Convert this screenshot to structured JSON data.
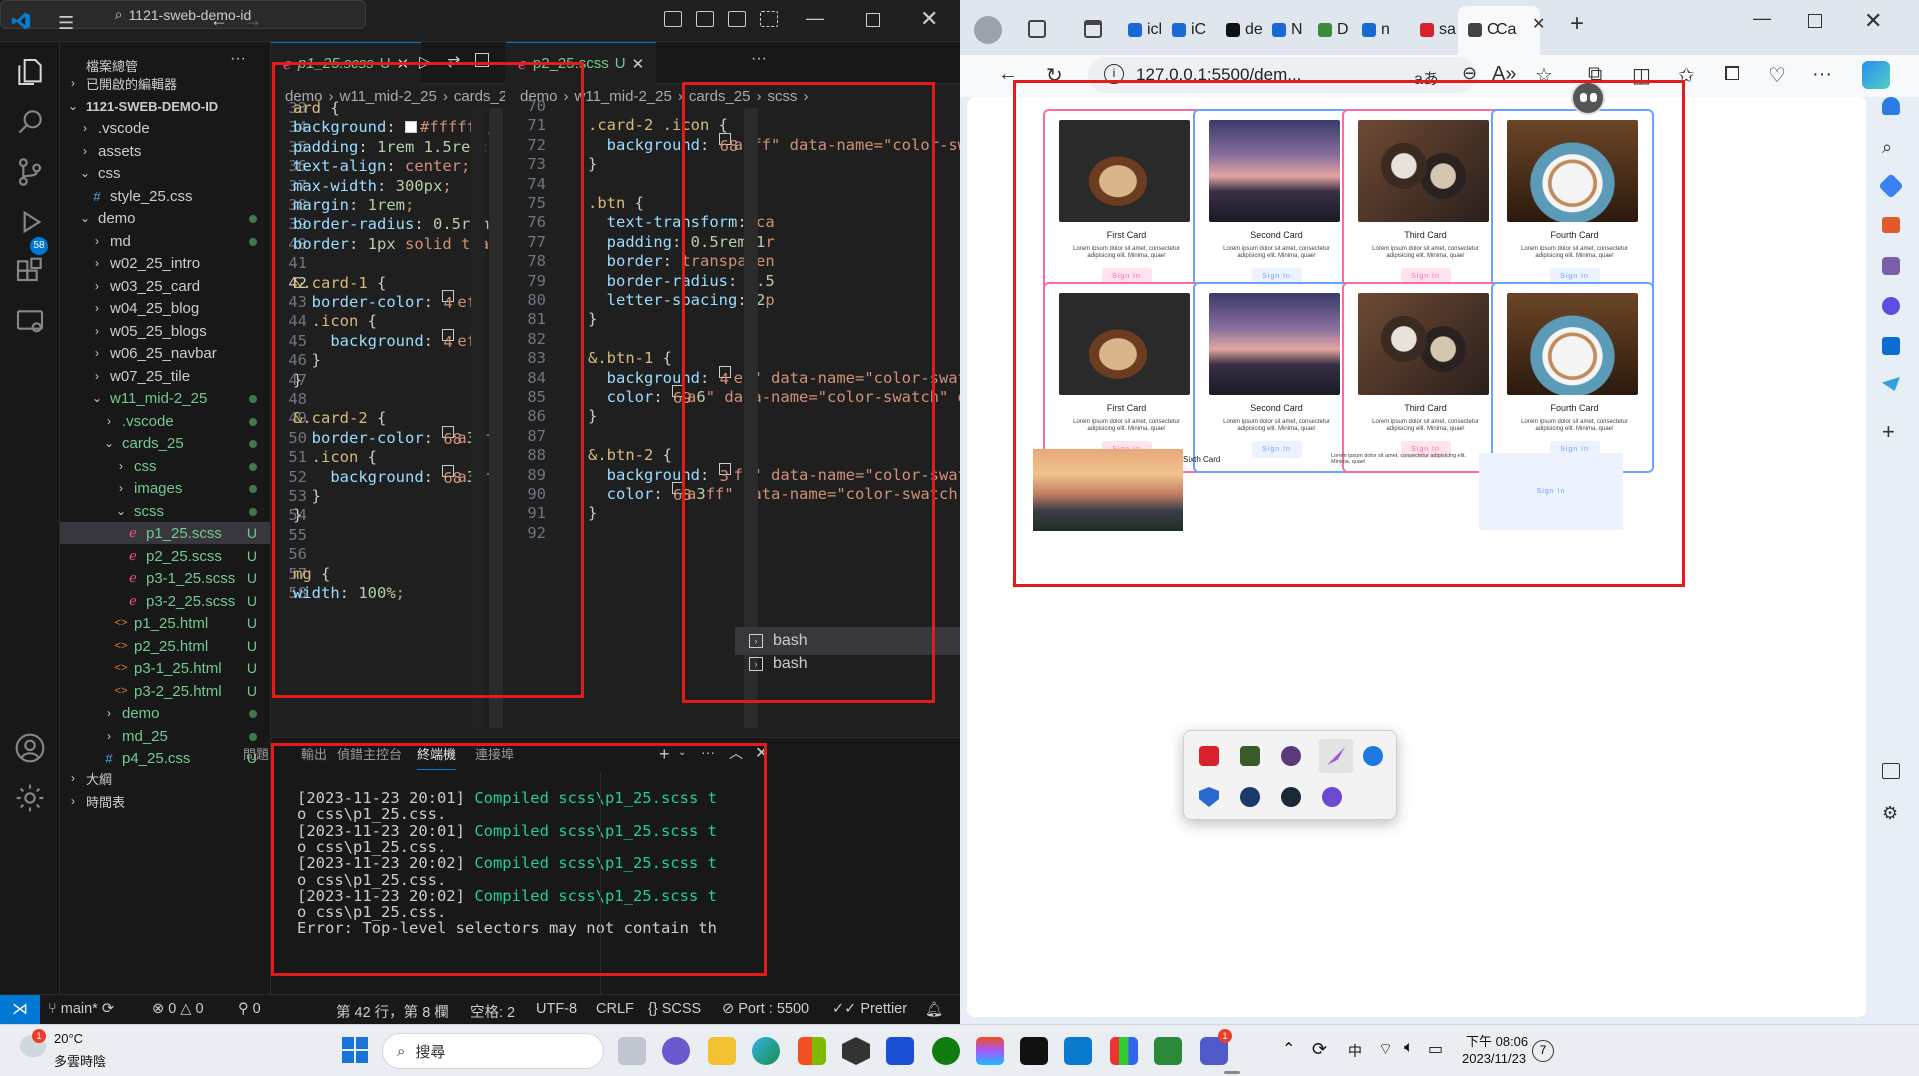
{
  "vscode": {
    "search": "1121-sweb-demo-id",
    "sidebar": {
      "header": "檔案總管",
      "items": [
        {
          "label": "已開啟的編輯器",
          "indent": 0,
          "kind": "folder",
          "open": false
        },
        {
          "label": "1121-SWEB-DEMO-ID",
          "indent": 0,
          "kind": "folder",
          "open": true,
          "bold": true
        },
        {
          "label": ".vscode",
          "indent": 1,
          "kind": "folder",
          "open": false
        },
        {
          "label": "assets",
          "indent": 1,
          "kind": "folder",
          "open": false
        },
        {
          "label": "css",
          "indent": 1,
          "kind": "folder",
          "open": true
        },
        {
          "label": "style_25.css",
          "indent": 2,
          "kind": "css"
        },
        {
          "label": "demo",
          "indent": 1,
          "kind": "folder",
          "open": true,
          "dot": true
        },
        {
          "label": "md",
          "indent": 2,
          "kind": "folder",
          "open": false,
          "dot": true
        },
        {
          "label": "w02_25_intro",
          "indent": 2,
          "kind": "folder",
          "open": false
        },
        {
          "label": "w03_25_card",
          "indent": 2,
          "kind": "folder",
          "open": false
        },
        {
          "label": "w04_25_blog",
          "indent": 2,
          "kind": "folder",
          "open": false
        },
        {
          "label": "w05_25_blogs",
          "indent": 2,
          "kind": "folder",
          "open": false
        },
        {
          "label": "w06_25_navbar",
          "indent": 2,
          "kind": "folder",
          "open": false
        },
        {
          "label": "w07_25_tile",
          "indent": 2,
          "kind": "folder",
          "open": false
        },
        {
          "label": "w11_mid-2_25",
          "indent": 2,
          "kind": "folder",
          "open": true,
          "dot": true,
          "git": true
        },
        {
          "label": ".vscode",
          "indent": 3,
          "kind": "folder",
          "open": false,
          "dot": true,
          "git": true
        },
        {
          "label": "cards_25",
          "indent": 3,
          "kind": "folder",
          "open": true,
          "dot": true,
          "git": true
        },
        {
          "label": "css",
          "indent": 4,
          "kind": "folder",
          "open": false,
          "dot": true,
          "git": true
        },
        {
          "label": "images",
          "indent": 4,
          "kind": "folder",
          "open": false,
          "dot": true,
          "git": true
        },
        {
          "label": "scss",
          "indent": 4,
          "kind": "folder",
          "open": true,
          "dot": true,
          "git": true
        },
        {
          "label": "p1_25.scss",
          "indent": 5,
          "kind": "scss",
          "status": "U",
          "selected": true
        },
        {
          "label": "p2_25.scss",
          "indent": 5,
          "kind": "scss",
          "status": "U"
        },
        {
          "label": "p3-1_25.scss",
          "indent": 5,
          "kind": "scss",
          "status": "U"
        },
        {
          "label": "p3-2_25.scss",
          "indent": 5,
          "kind": "scss",
          "status": "U"
        },
        {
          "label": "p1_25.html",
          "indent": 4,
          "kind": "html",
          "status": "U"
        },
        {
          "label": "p2_25.html",
          "indent": 4,
          "kind": "html",
          "status": "U"
        },
        {
          "label": "p3-1_25.html",
          "indent": 4,
          "kind": "html",
          "status": "U"
        },
        {
          "label": "p3-2_25.html",
          "indent": 4,
          "kind": "html",
          "status": "U"
        },
        {
          "label": "demo",
          "indent": 3,
          "kind": "folder",
          "open": false,
          "dot": true,
          "git": true
        },
        {
          "label": "md_25",
          "indent": 3,
          "kind": "folder",
          "open": false,
          "dot": true,
          "git": true
        },
        {
          "label": "p4_25.css",
          "indent": 3,
          "kind": "css",
          "status": "U"
        },
        {
          "label": "大綱",
          "indent": 0,
          "kind": "folder",
          "open": false
        },
        {
          "label": "時間表",
          "indent": 0,
          "kind": "folder",
          "open": false
        }
      ]
    },
    "left_editor": {
      "tab": "p1_25.scss",
      "tab_status": "U",
      "breadcrumb": [
        "demo",
        "w11_mid-2_25",
        "cards_25",
        "scss"
      ],
      "lines": [
        {
          "n": "33",
          "t": "ard {"
        },
        {
          "n": "34",
          "t": "background: #ffffff;"
        },
        {
          "n": "35",
          "t": "padding: 1rem 1.5rem;"
        },
        {
          "n": "36",
          "t": "text-align: center;"
        },
        {
          "n": "37",
          "t": "max-width: 300px;"
        },
        {
          "n": "38",
          "t": "margin: 1rem;"
        },
        {
          "n": "39",
          "t": "border-radius: 0.5rem;"
        },
        {
          "n": "40",
          "t": "border: 1px solid tran"
        },
        {
          "n": "41",
          "t": ""
        },
        {
          "n": "42",
          "t": "&.card-1 {"
        },
        {
          "n": "43",
          "t": "  border-color: #ffe"
        },
        {
          "n": "44",
          "t": "  .icon {"
        },
        {
          "n": "45",
          "t": "    background: #ffe"
        },
        {
          "n": "46",
          "t": "  }"
        },
        {
          "n": "47",
          "t": "}"
        },
        {
          "n": "48",
          "t": ""
        },
        {
          "n": "49",
          "t": "&.card-2 {"
        },
        {
          "n": "50",
          "t": "  border-color: #68a"
        },
        {
          "n": "51",
          "t": "  .icon {"
        },
        {
          "n": "52",
          "t": "    background: #68a"
        },
        {
          "n": "53",
          "t": "  }"
        },
        {
          "n": "54",
          "t": "}"
        },
        {
          "n": "55",
          "t": ""
        },
        {
          "n": "56",
          "t": ""
        },
        {
          "n": "57",
          "t": "mg {"
        },
        {
          "n": "58",
          "t": "width: 100%;"
        }
      ]
    },
    "right_editor": {
      "tab": "p2_25.scss",
      "tab_status": "U",
      "breadcrumb": [
        "demo",
        "w11_mid-2_25",
        "cards_25",
        "scss"
      ],
      "lines": [
        {
          "n": "70",
          "t": ""
        },
        {
          "n": "71",
          "t": ".card-2 .icon {"
        },
        {
          "n": "72",
          "t": "  background: #68a"
        },
        {
          "n": "73",
          "t": "}"
        },
        {
          "n": "74",
          "t": ""
        },
        {
          "n": "75",
          "t": ".btn {"
        },
        {
          "n": "76",
          "t": "  text-transform: ca"
        },
        {
          "n": "77",
          "t": "  padding: 0.5rem 1r"
        },
        {
          "n": "78",
          "t": "  border: transparen"
        },
        {
          "n": "79",
          "t": "  border-radius: 0.5"
        },
        {
          "n": "80",
          "t": "  letter-spacing: 2p"
        },
        {
          "n": "81",
          "t": "}"
        },
        {
          "n": "82",
          "t": ""
        },
        {
          "n": "83",
          "t": "&.btn-1 {"
        },
        {
          "n": "84",
          "t": "  background: #ffe"
        },
        {
          "n": "85",
          "t": "  color: #ff69a6;"
        },
        {
          "n": "86",
          "t": "}"
        },
        {
          "n": "87",
          "t": ""
        },
        {
          "n": "88",
          "t": "&.btn-2 {"
        },
        {
          "n": "89",
          "t": "  background: #ecf"
        },
        {
          "n": "90",
          "t": "  color: #68a3ff;"
        },
        {
          "n": "91",
          "t": "}"
        },
        {
          "n": "92",
          "t": ""
        }
      ]
    },
    "panel": {
      "tabs": [
        "問題",
        "輸出",
        "偵錯主控台",
        "終端機",
        "連接埠"
      ],
      "active_tab": "終端機",
      "terminal": [
        "[2023-11-23 20:01] Compiled scss\\p1_25.scss t",
        "o css\\p1_25.css.",
        "[2023-11-23 20:01] Compiled scss\\p1_25.scss t",
        "o css\\p1_25.css.",
        "[2023-11-23 20:02] Compiled scss\\p1_25.scss t",
        "o css\\p1_25.css.",
        "[2023-11-23 20:02] Compiled scss\\p1_25.scss t",
        "o css\\p1_25.css.",
        "Error: Top-level selectors may not contain th"
      ],
      "shells": [
        "bash",
        "bash"
      ]
    },
    "status": {
      "branch": "main*",
      "errors": "0",
      "warnings": "0",
      "ports": "0",
      "position": "第 42 行，第 8 欄",
      "spaces": "空格: 2",
      "encoding": "UTF-8",
      "eol": "CRLF",
      "language": "SCSS",
      "port": "Port : 5500",
      "prettier": "Prettier"
    }
  },
  "browser": {
    "tabs": [
      "icl",
      "iC",
      "de",
      "N",
      "D",
      "n",
      "sa",
      "C",
      "Ca"
    ],
    "url": "127.0.0.1:5500/dem...",
    "cards_row": [
      {
        "title": "First Card",
        "text": "Lorem ipsum dolor sit amet, consectetur adipisicing elit. Minima, quae!",
        "button": "Sign In",
        "variant": "1",
        "image": "latte-art"
      },
      {
        "title": "Second Card",
        "text": "Lorem ipsum dolor sit amet, consectetur adipisicing elit. Minima, quae!",
        "button": "Sign In",
        "variant": "2",
        "image": "bridge-dusk"
      },
      {
        "title": "Third Card",
        "text": "Lorem ipsum dolor sit amet, consectetur adipisicing elit. Minima, quae!",
        "button": "Sign In",
        "variant": "1",
        "image": "coffee-cups"
      },
      {
        "title": "Fourth Card",
        "text": "Lorem ipsum dolor sit amet, consectetur adipisicing elit. Minima, quae!",
        "button": "Sign In",
        "variant": "2",
        "image": "coffee-cup"
      }
    ],
    "sixth": {
      "title": "Sixth Card",
      "text": "Lorem ipsum dolor sit amet, consectetur adipisicing elit. Minima, quae!",
      "button": "Sign In",
      "image": "city-skyline"
    }
  },
  "taskbar": {
    "weather_temp": "20°C",
    "weather_desc": "多雲時陰",
    "weather_badge": "1",
    "search": "搜尋",
    "lang": "中",
    "time": "下午 08:06",
    "date": "2023/11/23",
    "notif": "7",
    "teams_badge": "1"
  }
}
